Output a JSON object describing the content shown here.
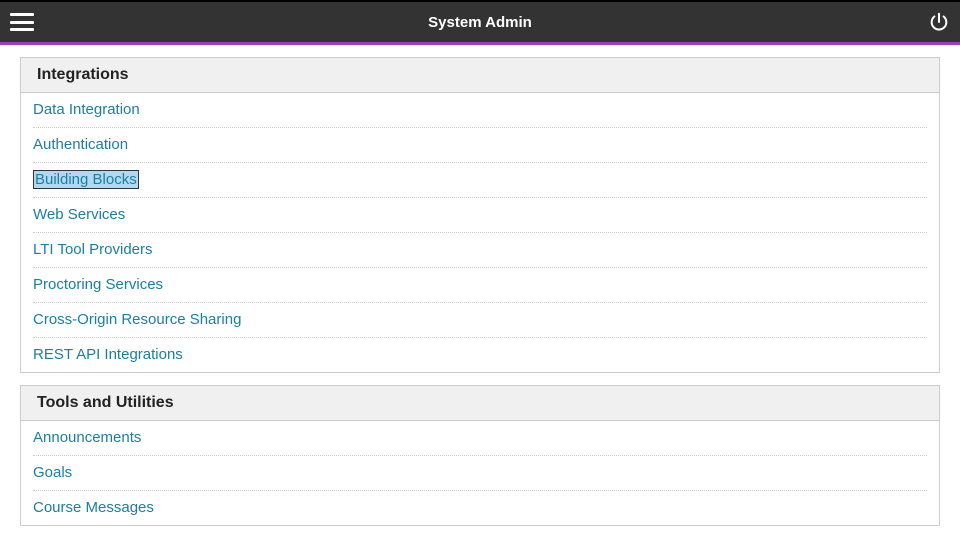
{
  "header": {
    "title": "System Admin"
  },
  "panels": [
    {
      "title": "Integrations",
      "items": [
        {
          "label": "Data Integration",
          "highlight": false
        },
        {
          "label": "Authentication",
          "highlight": false
        },
        {
          "label": "Building Blocks",
          "highlight": true
        },
        {
          "label": "Web Services",
          "highlight": false
        },
        {
          "label": "LTI Tool Providers",
          "highlight": false
        },
        {
          "label": "Proctoring Services",
          "highlight": false
        },
        {
          "label": "Cross-Origin Resource Sharing",
          "highlight": false
        },
        {
          "label": "REST API Integrations",
          "highlight": false
        }
      ]
    },
    {
      "title": "Tools and Utilities",
      "items": [
        {
          "label": "Announcements",
          "highlight": false
        },
        {
          "label": "Goals",
          "highlight": false
        },
        {
          "label": "Course Messages",
          "highlight": false
        }
      ]
    }
  ]
}
